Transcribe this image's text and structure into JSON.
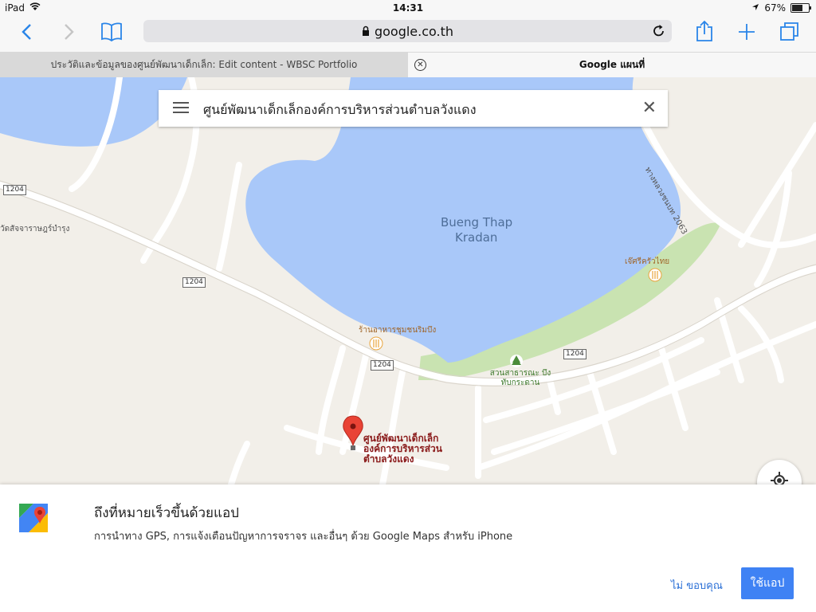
{
  "status": {
    "device": "iPad",
    "time": "14:31",
    "battery": "67%",
    "battery_level": 0.67
  },
  "toolbar": {
    "url": "google.co.th",
    "icons": [
      "back-icon",
      "forward-icon",
      "bookmarks-icon",
      "lock-icon",
      "reload-icon",
      "share-icon",
      "new-tab-icon",
      "tabs-icon"
    ]
  },
  "tabs": [
    {
      "label": "ประวัติและข้อมูลของศูนย์พัฒนาเด็กเล็ก: Edit content - WBSC Portfolio"
    },
    {
      "label": "Google แผนที่"
    }
  ],
  "search": {
    "query": "ศูนย์พัฒนาเด็กเล็กองค์การบริหารส่วนตำบลวังแดง"
  },
  "map": {
    "labels": {
      "lake": "Bueng Thap Kradan",
      "road_1204": "1204",
      "road_2063": "ทางหลวงชนบท 2063",
      "temple": "วัดสัจจาราษฎร์บำรุง",
      "restaurant1": "ร้านอาหารชุมชนริมบึง",
      "restaurant2": "เจ๊ศรีครัวไทย",
      "park": "สวนสาธารณะ บึงทับกระดาน",
      "pin": "ศูนย์พัฒนาเด็กเล็กองค์การบริหารส่วนตำบลวังแดง"
    },
    "colors": {
      "water": "#a9c8f9",
      "park": "#c9e3b1",
      "road": "#ffffff",
      "pin": "#e94335",
      "pin_text": "#8a1a1a"
    }
  },
  "banner": {
    "title": "ถึงที่หมายเร็วขึ้นด้วยแอป",
    "subtitle": "การนำทาง GPS, การแจ้งเตือนปัญหาการจราจร และอื่นๆ ด้วย Google Maps สำหรับ iPhone",
    "dismiss_label": "ไม่ ขอบคุณ",
    "use_app_label": "ใช้แอป"
  }
}
